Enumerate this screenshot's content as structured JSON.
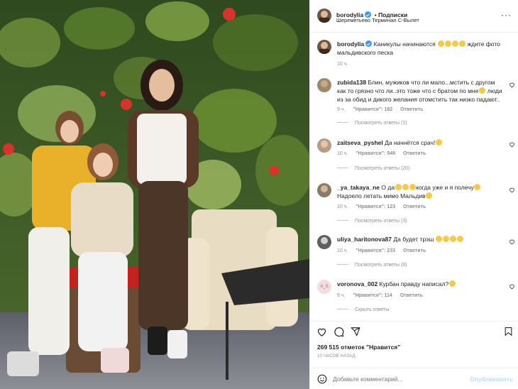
{
  "post": {
    "username": "borodylia",
    "follow_label": "Подписки",
    "location": "Шереметьево Терминал С-Вылет",
    "caption_text": "Каникулы начинаются",
    "caption_text2": "ждите фото мальдивского песка",
    "caption_time": "10 ч.",
    "likes": "269 515 отметок \"Нравится\"",
    "time_ago": "10 ЧАСОВ НАЗАД",
    "add_comment_placeholder": "Добавьте комментарий...",
    "publish_label": "Опубликовать"
  },
  "comments": [
    {
      "username": "zubida138",
      "text": "Блин, мужиков что ли мало...мстить с другом как то грязно что ли..это тоже что с братом по мне",
      "text2": "люди из за обид и дикого желания отомстить так низко падают..",
      "time": "9 ч.",
      "likes": "\"Нравится\": 182",
      "reply": "Ответить",
      "view_replies": "Посмотреть ответы (1)"
    },
    {
      "username": "zaitseva_pyshel",
      "text": "Да начнётся срач!",
      "time": "10 ч.",
      "likes": "\"Нравится\": 549",
      "reply": "Ответить",
      "view_replies": "Посмотреть ответы (20)"
    },
    {
      "username": "_ya_takaya_ne",
      "text": "О да",
      "text2": "когда уже и я полечу",
      "text3": "Надоело летать мимо Мальдив",
      "time": "10 ч.",
      "likes": "\"Нравится\": 123",
      "reply": "Ответить",
      "view_replies": "Посмотреть ответы (3)"
    },
    {
      "username": "uliya_haritonova87",
      "text": "Да будет трэш",
      "time": "10 ч.",
      "likes": "\"Нравится\": 233",
      "reply": "Ответить",
      "view_replies": "Посмотреть ответы (6)"
    },
    {
      "username": "voronova_002",
      "avatar_text": "A_S",
      "text": "Курбан правду написал?",
      "time": "9 ч.",
      "likes": "\"Нравится\": 114",
      "reply": "Ответить",
      "view_replies": "Скрыть ответы"
    }
  ],
  "colors": {
    "accent": "#3897f0",
    "muted": "#8e8e8e",
    "publish_disabled": "#b2dffc",
    "border": "#efefef"
  },
  "icons": [
    "heart-icon",
    "comment-icon",
    "share-icon",
    "bookmark-icon",
    "emoji-icon",
    "more-icon",
    "verified-icon"
  ]
}
